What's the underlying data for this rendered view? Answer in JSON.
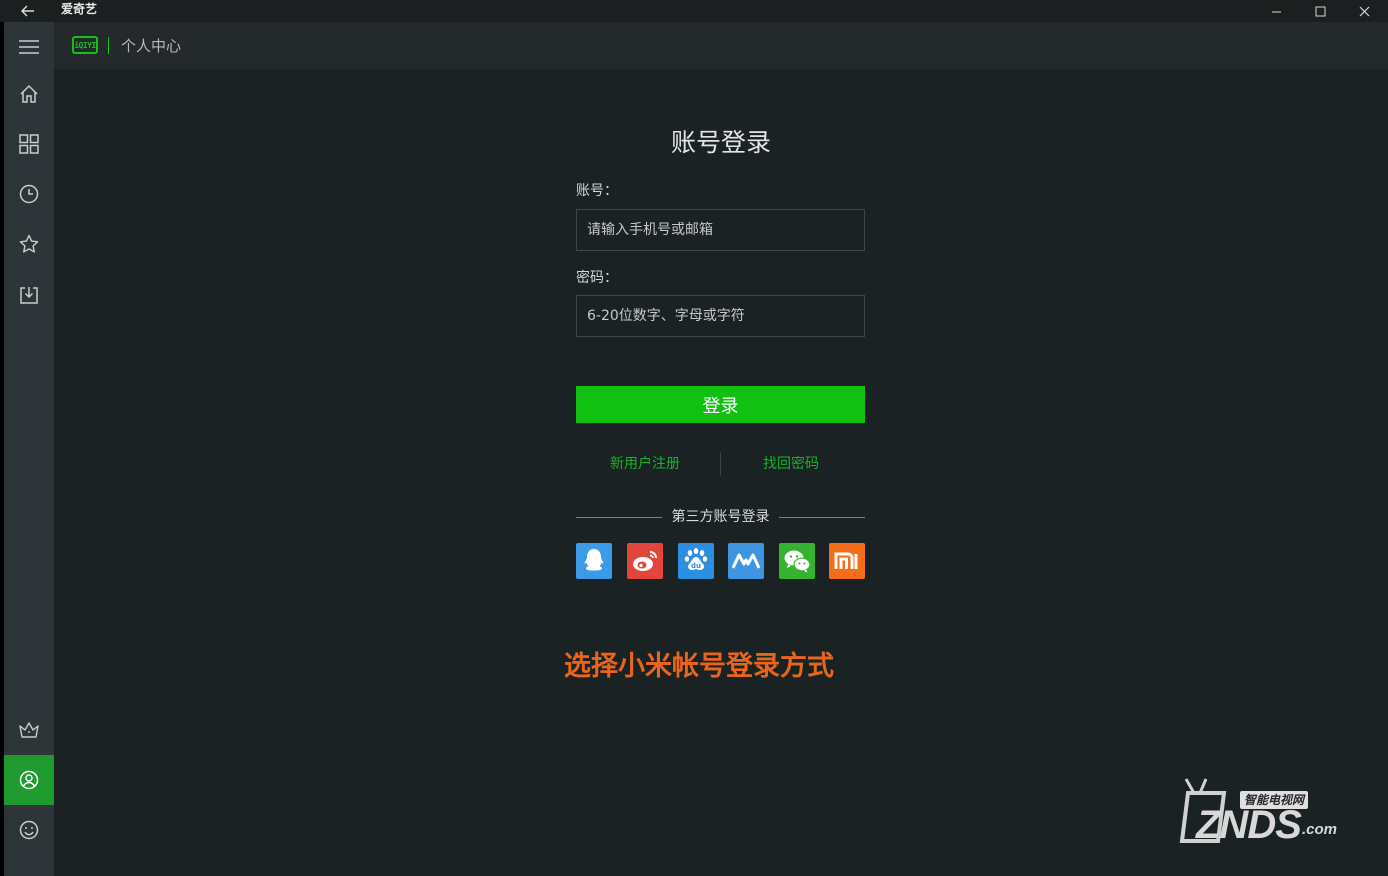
{
  "window": {
    "title": "爱奇艺",
    "controls": [
      "minimize-icon",
      "maximize-icon",
      "close-icon"
    ]
  },
  "header": {
    "logo_text": "iQIYI",
    "breadcrumb": "个人中心"
  },
  "sidebar": {
    "items": [
      {
        "icon": "menu-icon"
      },
      {
        "icon": "home-icon"
      },
      {
        "icon": "category-grid-icon"
      },
      {
        "icon": "history-icon"
      },
      {
        "icon": "favorite-star-icon"
      },
      {
        "icon": "download-icon"
      },
      {
        "icon": "vip-crown-icon"
      },
      {
        "icon": "user-icon",
        "active": true
      },
      {
        "icon": "smiley-icon"
      }
    ]
  },
  "login": {
    "title": "账号登录",
    "account_label": "账号：",
    "account_placeholder": "请输入手机号或邮箱",
    "password_label": "密码：",
    "password_placeholder": "6-20位数字、字母或字符",
    "submit_label": "登录",
    "register_link": "新用户注册",
    "recover_link": "找回密码",
    "third_party_label": "第三方账号登录",
    "third_party": [
      {
        "name": "QQ",
        "icon": "qq-icon",
        "color": "#3c9be6"
      },
      {
        "name": "微博",
        "icon": "weibo-icon",
        "color": "#e2443e"
      },
      {
        "name": "百度",
        "icon": "baidu-icon",
        "color": "#2e8ee0"
      },
      {
        "name": "PPS",
        "icon": "pps-icon",
        "color": "#3f95e0"
      },
      {
        "name": "微信",
        "icon": "wechat-icon",
        "color": "#35b22e"
      },
      {
        "name": "小米",
        "icon": "xiaomi-icon",
        "color": "#f36d1a"
      }
    ]
  },
  "caption": "选择小米帐号登录方式",
  "watermark": {
    "badge": "智能电视网",
    "main": "ZNDS",
    "suffix": ".com"
  },
  "colors": {
    "accent_green": "#12c012",
    "link_green": "#17b32b",
    "caption_orange": "#e8661c",
    "background": "#1b2224",
    "rail": "#2d3538"
  }
}
